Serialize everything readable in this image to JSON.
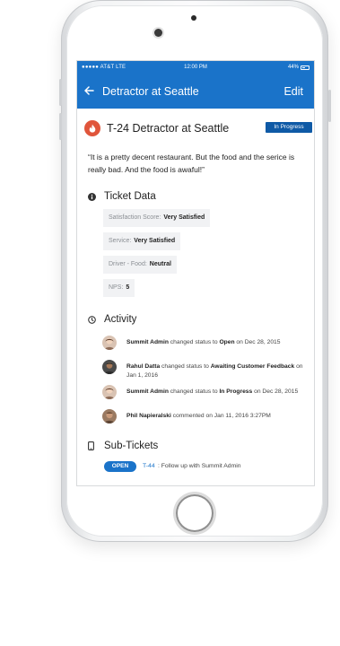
{
  "status_bar": {
    "carrier": "●●●●● AT&T  LTE",
    "time": "12:00 PM",
    "battery": "44%"
  },
  "nav": {
    "back_icon": "arrow-left-icon",
    "title": "Detractor at Seattle",
    "edit_label": "Edit"
  },
  "ticket": {
    "icon": "flame-icon",
    "title": "T-24 Detractor at Seattle",
    "status": "In Progress",
    "quote": "“It is a pretty decent restaurant. But the food and the serice is really bad. And the food is awaful!”"
  },
  "ticket_data": {
    "heading": "Ticket Data",
    "icon": "info-icon",
    "fields": [
      {
        "key": "Satisfaction Score:",
        "value": "Very Satisfied"
      },
      {
        "key": "Service:",
        "value": "Very Satisfied"
      },
      {
        "key": "Driver - Food:",
        "value": "Neutral"
      },
      {
        "key": "NPS:",
        "value": "5"
      }
    ]
  },
  "activity": {
    "heading": "Activity",
    "icon": "clock-icon",
    "items": [
      {
        "user": "Summit Admin",
        "action": "changed status to",
        "target": "Open",
        "suffix": "on Dec 28, 2015"
      },
      {
        "user": "Rahul Datta",
        "action": "changed status to",
        "target": "Awaiting Customer Feedback",
        "suffix": "on Jan 1, 2016"
      },
      {
        "user": "Summit Admin",
        "action": "changed status to",
        "target": "In Progress",
        "suffix": "on Dec 28, 2015"
      },
      {
        "user": "Phil Napieralski",
        "action": "commented",
        "target": "",
        "suffix": "on Jan 11, 2016 3:27PM"
      }
    ]
  },
  "subtickets": {
    "heading": "Sub-Tickets",
    "icon": "mobile-icon",
    "items": [
      {
        "status": "OPEN",
        "id": "T-44",
        "title": ": Follow up with Summit Admin"
      }
    ]
  },
  "colors": {
    "primary": "#1a73c9",
    "badge": "#0f5aa6",
    "flame": "#e0553b",
    "chip_bg": "#f1f2f4"
  }
}
